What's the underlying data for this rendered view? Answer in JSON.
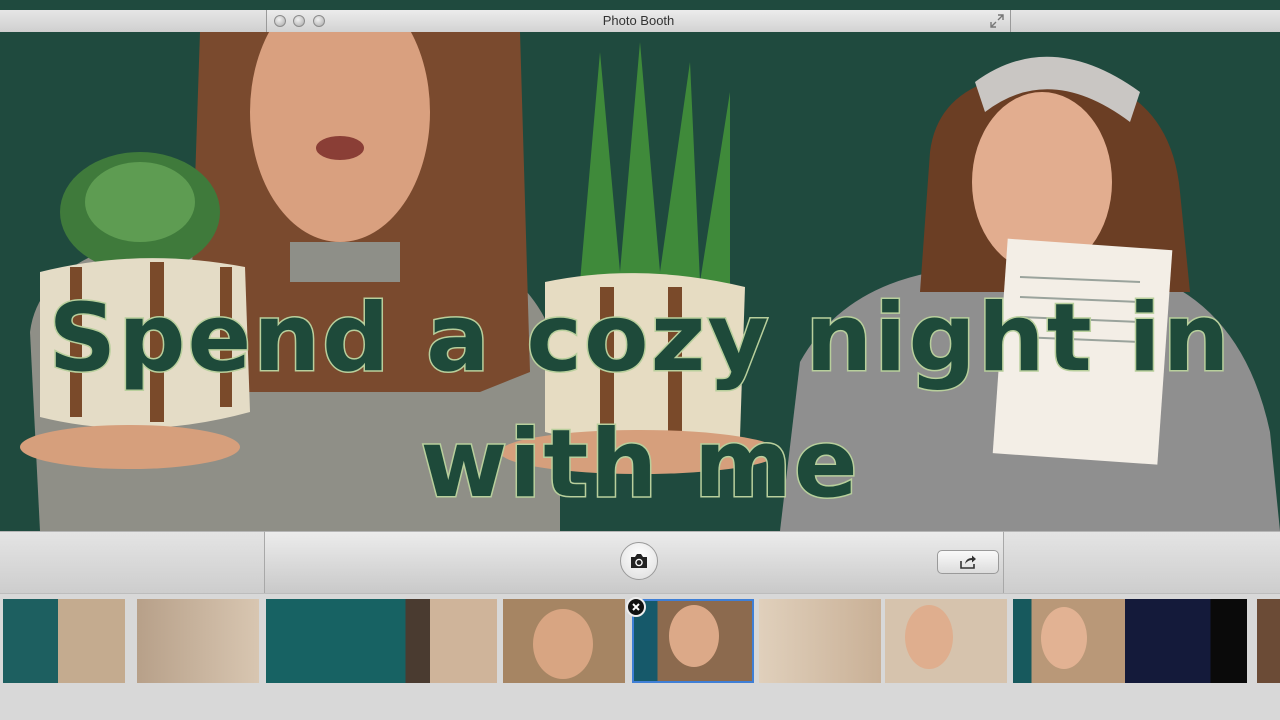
{
  "window": {
    "title": "Photo Booth"
  },
  "overlay": {
    "line1": "Spend a cozy night in",
    "line2": "with me"
  },
  "toolbar": {
    "shutter_icon": "camera-icon",
    "share_icon": "share-arrow-icon"
  },
  "filmstrip": {
    "thumbnails": [
      {
        "scene": "teal-room"
      },
      {
        "scene": "beige-wall"
      },
      {
        "scene": "teal"
      },
      {
        "scene": "teal-door"
      },
      {
        "scene": "face-closeup"
      },
      {
        "scene": "face-selected",
        "selected": true
      },
      {
        "scene": "hallway"
      },
      {
        "scene": "face-wave"
      },
      {
        "scene": "face-teal"
      },
      {
        "scene": "dark-blue"
      },
      {
        "scene": "partial"
      }
    ]
  },
  "colors": {
    "stage_bg": "#1f4a3e",
    "overlay_fill": "#1e4a3a",
    "overlay_stroke": "#b8cf9c",
    "selection": "#3f7fd6"
  }
}
